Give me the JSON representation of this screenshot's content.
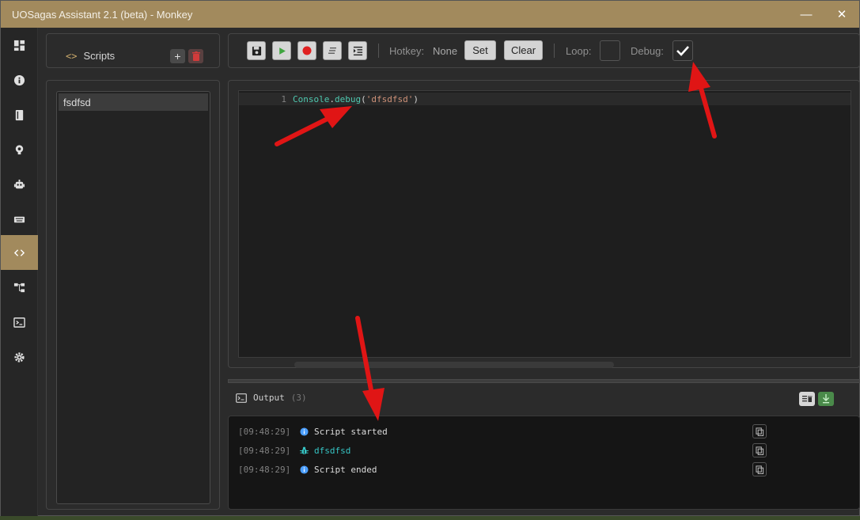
{
  "window": {
    "title": "UOSagas Assistant 2.1 (beta) - Monkey"
  },
  "window_controls": {
    "minimize": "—",
    "close": "✕"
  },
  "sidebar": {
    "items": [
      {
        "icon": "dashboard-icon"
      },
      {
        "icon": "info-icon"
      },
      {
        "icon": "book-icon"
      },
      {
        "icon": "bulb-icon"
      },
      {
        "icon": "robot-icon"
      },
      {
        "icon": "keyboard-icon"
      },
      {
        "icon": "code-icon",
        "active": true
      },
      {
        "icon": "hierarchy-icon"
      },
      {
        "icon": "terminal-icon"
      },
      {
        "icon": "gear-icon"
      }
    ]
  },
  "scripts": {
    "header_label": "Scripts",
    "code_glyph": "<>",
    "add": "+",
    "items": [
      {
        "name": "fsdfsd"
      }
    ]
  },
  "toolbar": {
    "hotkey_label": "Hotkey:",
    "hotkey_value": "None",
    "set_label": "Set",
    "clear_label": "Clear",
    "loop_label": "Loop:",
    "debug_label": "Debug:",
    "debug_checked": true
  },
  "editor": {
    "line_number": "1",
    "code": {
      "cls": "Console",
      "dot": ".",
      "fn": "debug",
      "open": "(",
      "str": "'dfsdfsd'",
      "close": ")"
    }
  },
  "output": {
    "label": "Output",
    "count": "(3)",
    "logs": [
      {
        "time": "[09:48:29]",
        "level": "info",
        "message": "Script started"
      },
      {
        "time": "[09:48:29]",
        "level": "debug",
        "message": "dfsdfsd"
      },
      {
        "time": "[09:48:29]",
        "level": "info",
        "message": "Script ended"
      }
    ]
  },
  "colors": {
    "accent": "#a28a5d",
    "debug_text": "#36c4c4",
    "info_icon": "#4a9eff",
    "arrow": "#e01515"
  }
}
